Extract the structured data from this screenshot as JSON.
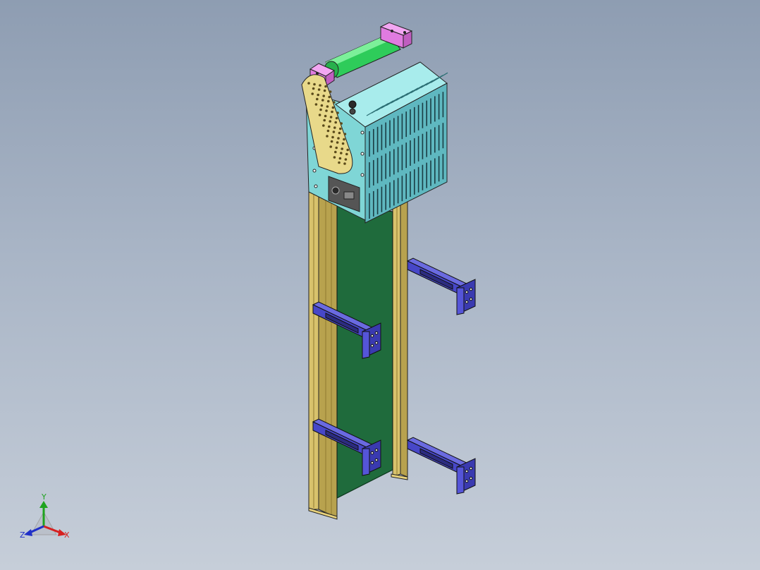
{
  "viewport": {
    "background_top": "#8e9db2",
    "background_bottom": "#c6ced9"
  },
  "triad": {
    "x_label": "X",
    "y_label": "Y",
    "z_label": "Z",
    "x_color": "#d62020",
    "y_color": "#1fa31f",
    "z_color": "#2030c8"
  },
  "model": {
    "frame_color": "#c9b25c",
    "belt_color": "#1f6b3c",
    "roller_color": "#2ecc5a",
    "housing_color": "#7fd6d6",
    "bracket_color": "#4747c8",
    "pillow_block_color": "#e07be0",
    "crank_color": "#e8d98a"
  }
}
